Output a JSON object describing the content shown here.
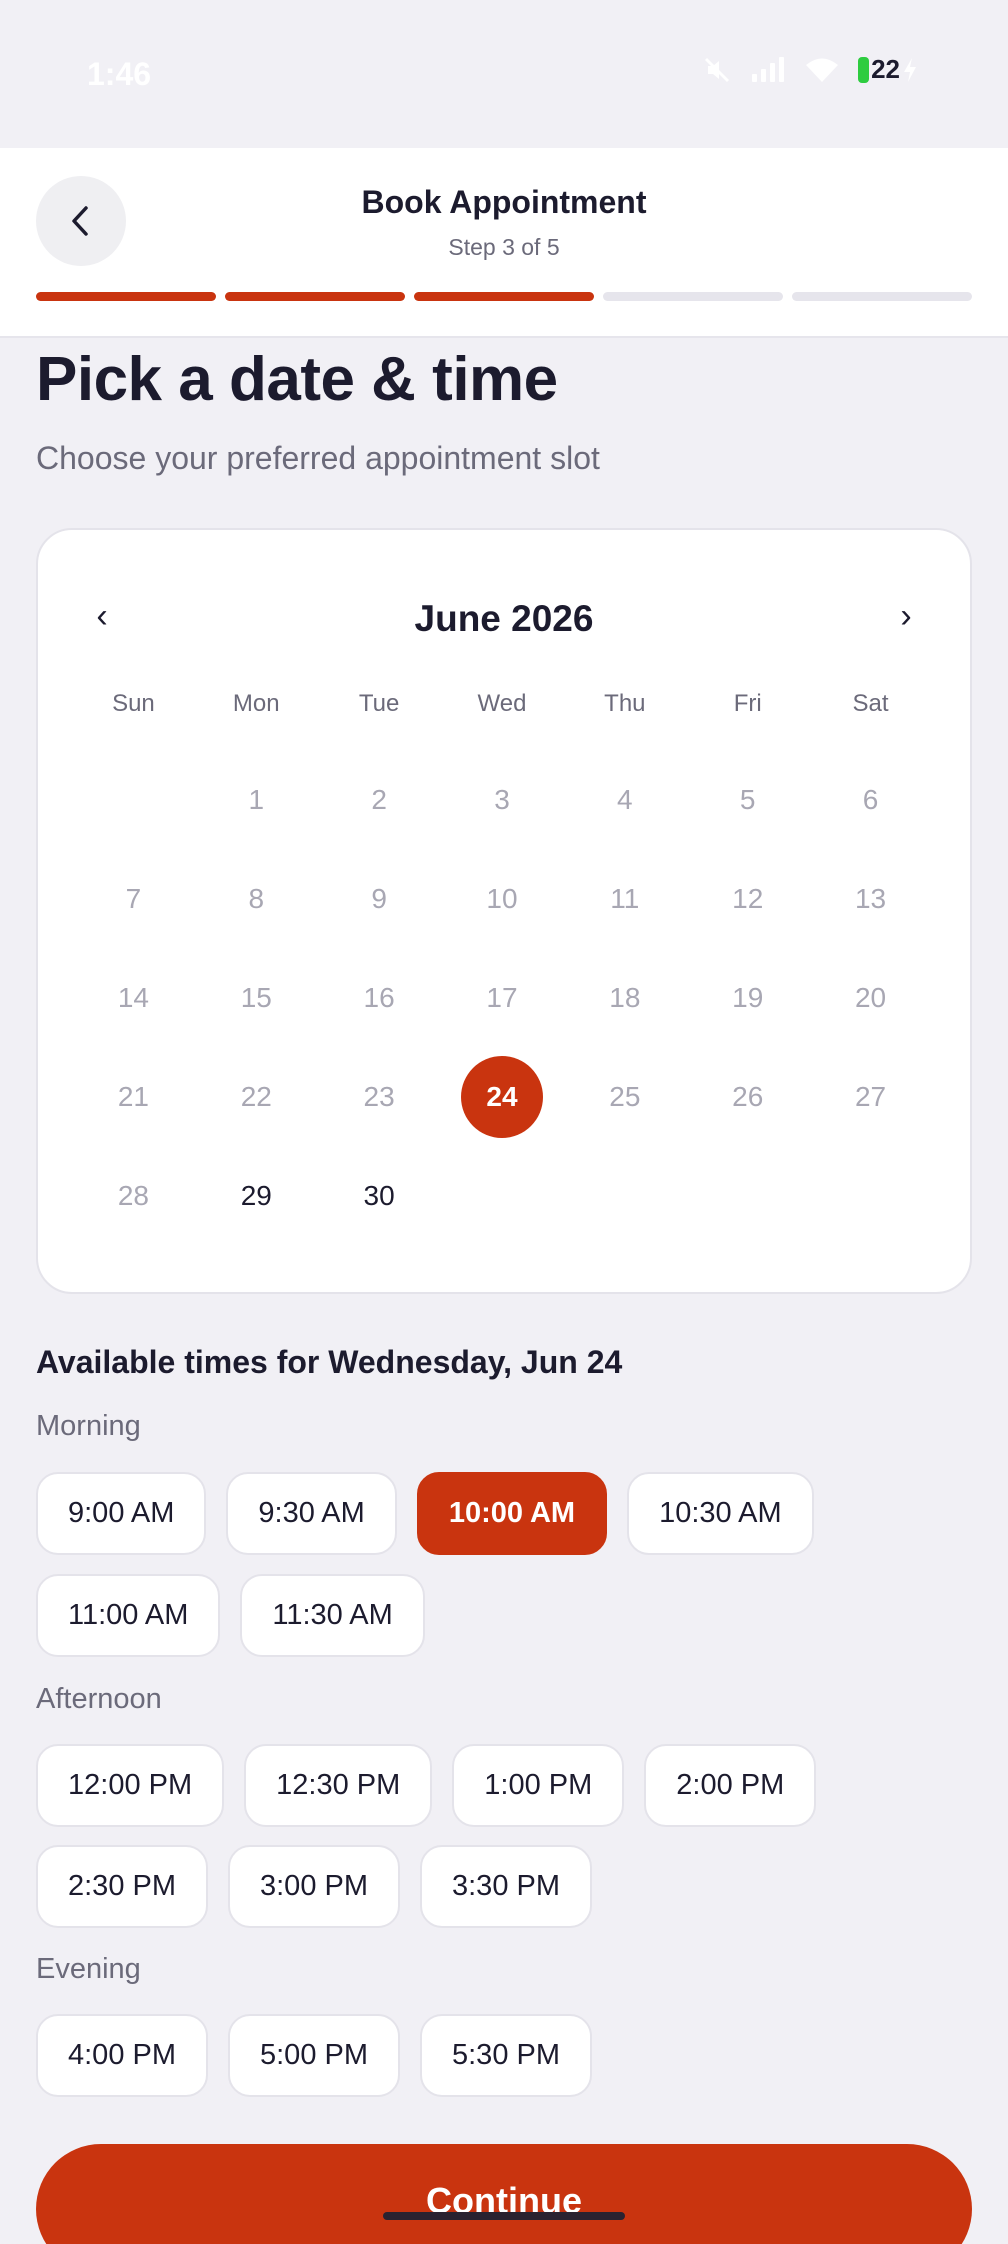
{
  "status_bar": {
    "time": "1:46",
    "battery": "22",
    "icons": [
      "mute-icon",
      "signal-icon",
      "wifi-icon",
      "battery-icon",
      "charging-icon"
    ]
  },
  "header": {
    "title": "Book Appointment",
    "step": "Step 3 of 5",
    "progress_completed": 3,
    "progress_total": 5
  },
  "page": {
    "title": "Pick a date & time",
    "subtitle": "Choose your preferred appointment slot"
  },
  "calendar": {
    "month_label": "June 2026",
    "prev_icon": "‹",
    "next_icon": "›",
    "weekdays": [
      "Sun",
      "Mon",
      "Tue",
      "Wed",
      "Thu",
      "Fri",
      "Sat"
    ],
    "days": [
      "",
      "1",
      "2",
      "3",
      "4",
      "5",
      "6",
      "7",
      "8",
      "9",
      "10",
      "11",
      "12",
      "13",
      "14",
      "15",
      "16",
      "17",
      "18",
      "19",
      "20",
      "21",
      "22",
      "23",
      "24",
      "25",
      "26",
      "27",
      "28",
      "29",
      "30"
    ],
    "selected_day": "24",
    "available_days": [
      "24",
      "29",
      "30"
    ]
  },
  "times": {
    "title": "Available times for Wednesday, Jun 24",
    "morning": {
      "label": "Morning",
      "row1": [
        "9:00 AM",
        "9:30 AM",
        "10:00 AM",
        "10:30 AM"
      ],
      "row2": [
        "11:00 AM",
        "11:30 AM"
      ]
    },
    "afternoon": {
      "label": "Afternoon",
      "row1": [
        "12:00 PM",
        "12:30 PM",
        "1:00 PM",
        "2:00 PM"
      ],
      "row2": [
        "2:30 PM",
        "3:00 PM",
        "3:30 PM"
      ]
    },
    "evening": {
      "label": "Evening",
      "row1": [
        "4:00 PM",
        "5:00 PM",
        "5:30 PM"
      ]
    },
    "selected": "10:00 AM"
  },
  "footer": {
    "continue_label": "Continue"
  },
  "colors": {
    "accent": "#c9340f",
    "background": "#f1f0f5",
    "text": "#1c1b2e",
    "muted": "#6b6a7a"
  }
}
